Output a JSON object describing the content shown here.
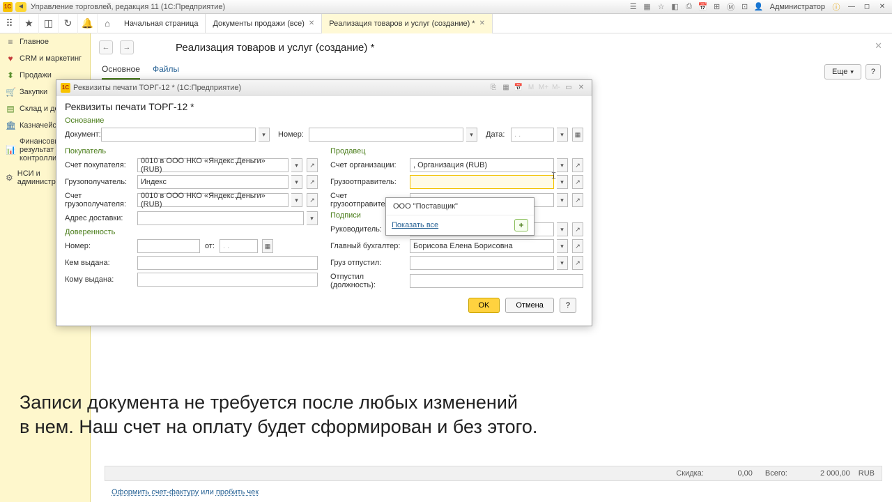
{
  "titlebar": {
    "app": "Управление торговлей, редакция 11  (1С:Предприятие)",
    "admin": "Администратор"
  },
  "tabs": {
    "home": "Начальная страница",
    "t1": "Документы продажи (все)",
    "t2": "Реализация товаров и услуг (создание) *"
  },
  "sidebar": {
    "i0": "Главное",
    "i1": "CRM и маркетинг",
    "i2": "Продажи",
    "i3": "Закупки",
    "i4": "Склад и доставка",
    "i5": "Казначейство",
    "i6": "Финансовый результат и контроллинг",
    "i7": "НСИ и администрирование"
  },
  "page": {
    "title": "Реализация товаров и услуг (создание) *",
    "subtab_main": "Основное",
    "subtab_files": "Файлы",
    "more": "Еще"
  },
  "modal": {
    "wintitle": "Реквизиты печати ТОРГ-12 *  (1С:Предприятие)",
    "title": "Реквизиты печати ТОРГ-12 *",
    "sect_basis": "Основание",
    "lbl_document": "Документ:",
    "lbl_number": "Номер:",
    "lbl_date": "Дата:",
    "date_ph": ".  .",
    "sect_buyer": "Покупатель",
    "lbl_acct_buyer": "Счет покупателя:",
    "val_acct_buyer": "0010 в ООО НКО «Яндекс.Деньги» (RUB)",
    "lbl_consignee": "Грузополучатель:",
    "val_consignee": "Индекс",
    "lbl_acct_consignee": "Счет грузополучателя:",
    "val_acct_consignee": "0010 в ООО НКО «Яндекс.Деньги» (RUB)",
    "lbl_addr": "Адрес доставки:",
    "sect_proxy": "Доверенность",
    "lbl_num2": "Номер:",
    "lbl_from": "от:",
    "lbl_issued_by": "Кем выдана:",
    "lbl_issued_to": "Кому выдана:",
    "sect_seller": "Продавец",
    "lbl_acct_org": "Счет организации:",
    "val_acct_org": ", Организация (RUB)",
    "lbl_shipper": "Грузоотправитель:",
    "lbl_acct_shipper": "Счет грузоотправителя:",
    "sect_sign": "Подписи",
    "lbl_head": "Руководитель:",
    "lbl_accountant": "Главный бухгалтер:",
    "val_accountant": "Борисова Елена Борисовна",
    "lbl_released": "Груз отпустил:",
    "lbl_released_pos": "Отпустил (должность):",
    "dd_opt": "ООО \"Поставщик\"",
    "dd_showall": "Показать все",
    "btn_ok": "OK",
    "btn_cancel": "Отмена"
  },
  "caption": {
    "line1": "Записи документа не требуется после любых изменений",
    "line2": "в нем. Наш счет на оплату будет сформирован и без этого."
  },
  "status": {
    "discount_lbl": "Скидка:",
    "discount_val": "0,00",
    "total_lbl": "Всего:",
    "total_val": "2 000,00",
    "currency": "RUB"
  },
  "footer": {
    "invoice": "Оформить счет-фактуру",
    "or": " или ",
    "receipt": "пробить чек"
  }
}
